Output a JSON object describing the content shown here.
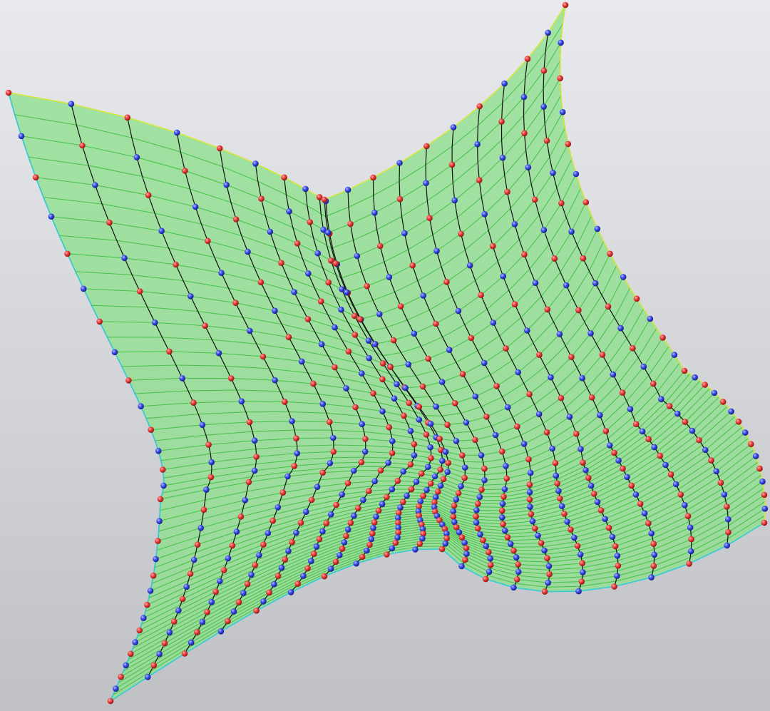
{
  "scene": {
    "kind": "3d-viewport",
    "content": "deformed-surface-mesh",
    "grid": {
      "columns": 21,
      "rows": 57
    },
    "colors": {
      "background_top": "#e8eaed",
      "background_bottom": "#bfc1c5",
      "surface_fill": "#8ee08e",
      "surface_edge": "#46c046",
      "mesh_line": "#101010",
      "border_cyan": "#33ccd6",
      "border_yellow": "#d4e83a",
      "node_red": "#ee3d3d",
      "node_blue": "#3b4cf0"
    },
    "icons": {
      "node": "sphere-node-icon"
    }
  }
}
